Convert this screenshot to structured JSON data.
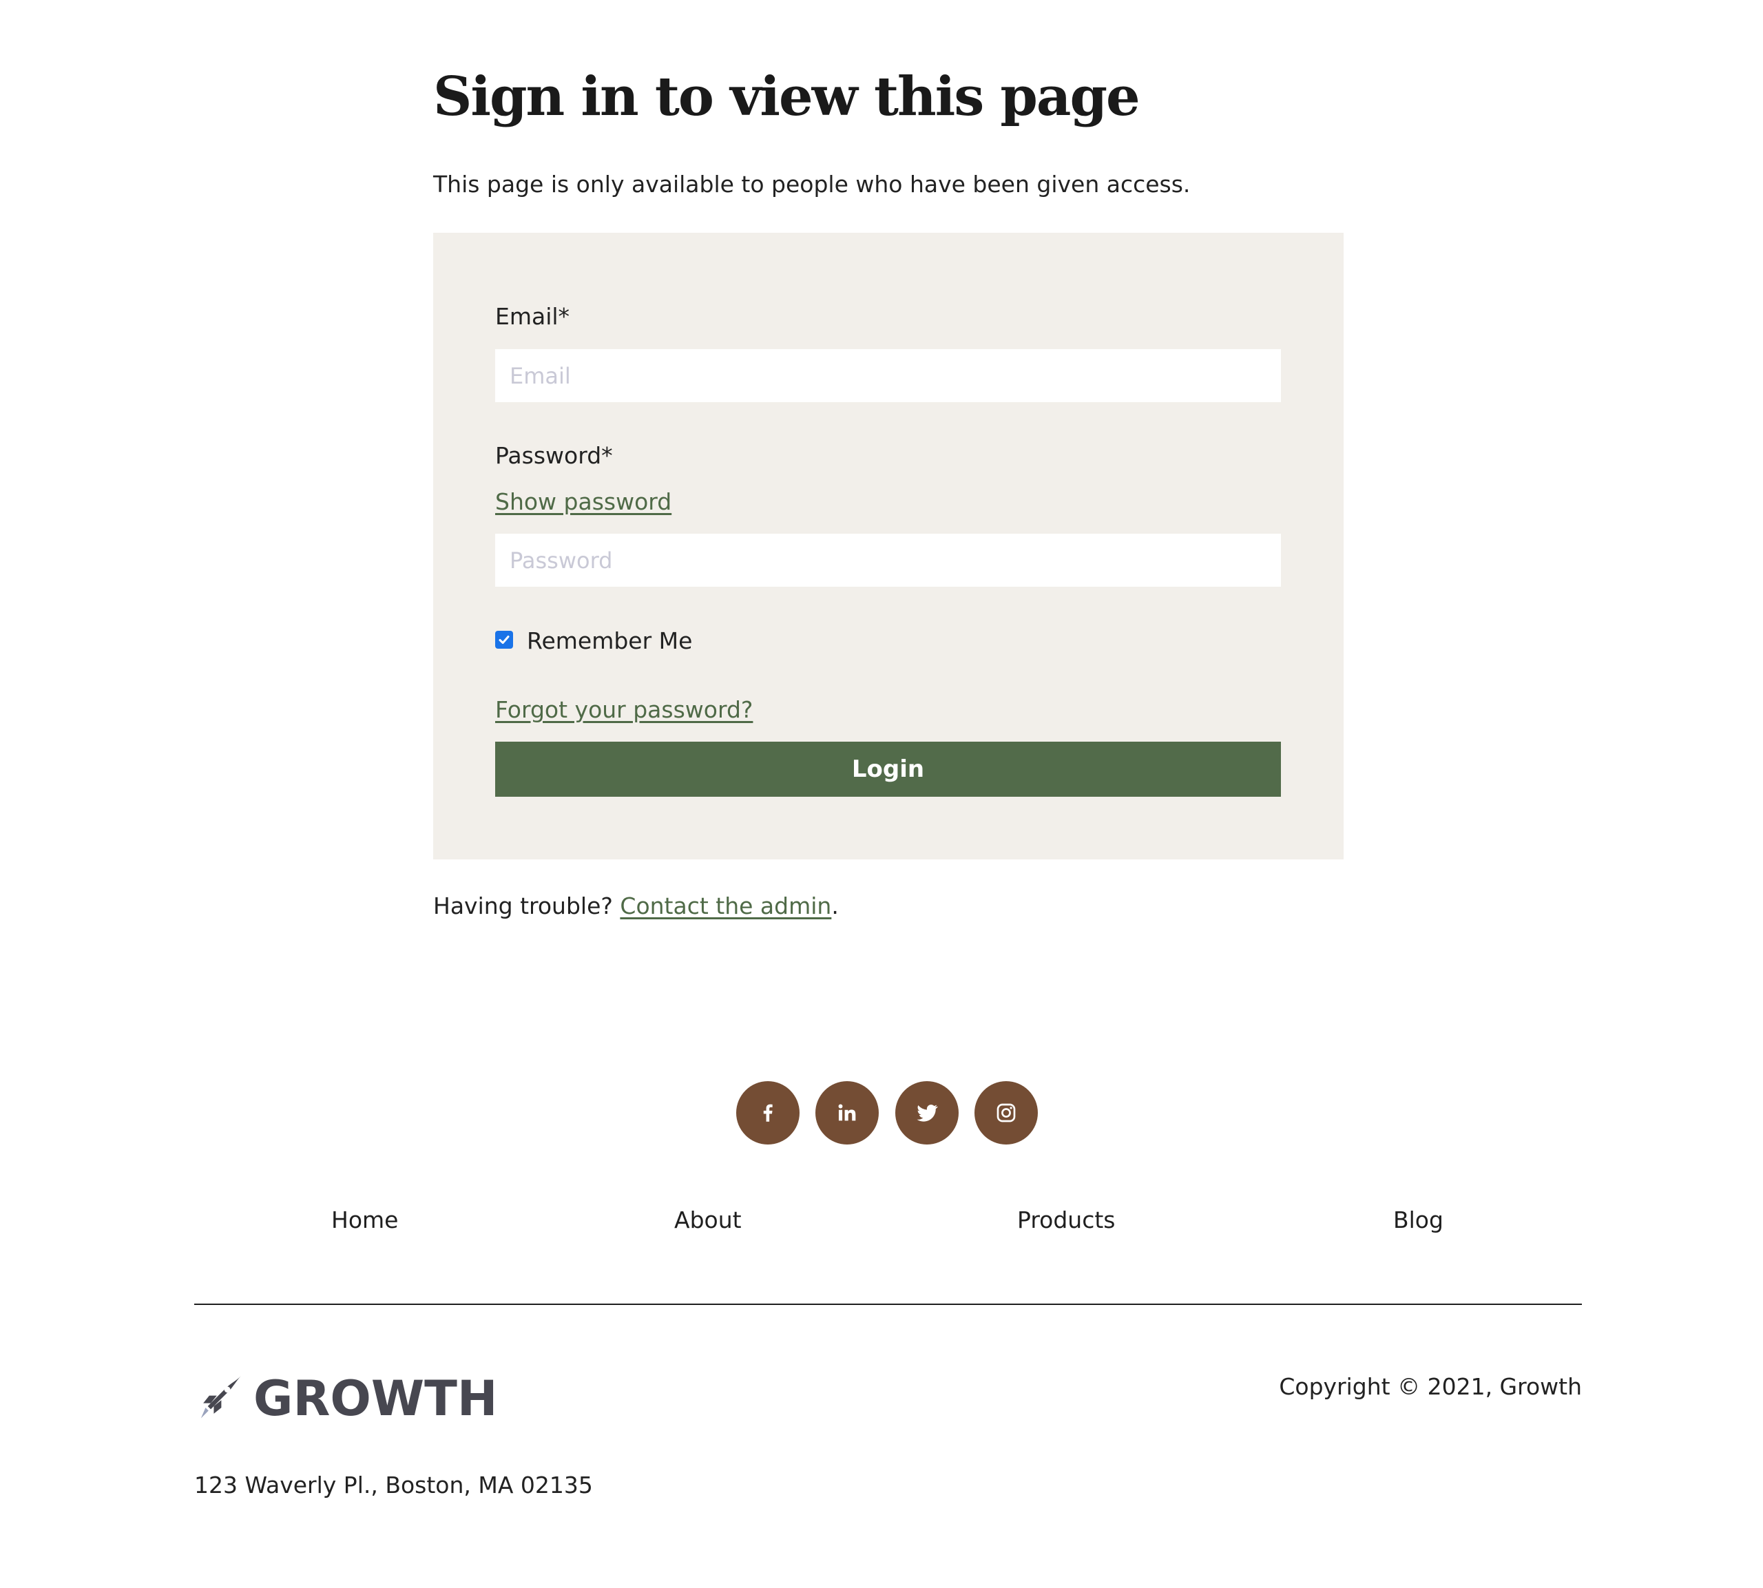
{
  "page": {
    "title": "Sign in to view this page",
    "subtitle": "This page is only available to people who have been given access."
  },
  "form": {
    "email_label": "Email*",
    "email_placeholder": "Email",
    "password_label": "Password*",
    "show_password": "Show password",
    "password_placeholder": "Password",
    "remember_me": "Remember Me",
    "remember_checked": true,
    "forgot_password": "Forgot your password?",
    "login_label": "Login"
  },
  "trouble": {
    "prefix": "Having trouble? ",
    "link": "Contact the admin",
    "suffix": "."
  },
  "social": [
    "facebook-icon",
    "linkedin-icon",
    "twitter-icon",
    "instagram-icon"
  ],
  "footer": {
    "nav": [
      "Home",
      "About",
      "Products",
      "Blog"
    ],
    "brand": "GROWTH",
    "copyright": "Copyright © 2021, Growth",
    "address": "123 Waverly Pl., Boston, MA 02135"
  },
  "colors": {
    "accent_green": "#526b4a",
    "link_green": "#4f6a47",
    "panel_bg": "#f2efea",
    "social_brown": "#744d34",
    "logo_gray": "#474750",
    "checkbox_blue": "#1a73e8"
  }
}
